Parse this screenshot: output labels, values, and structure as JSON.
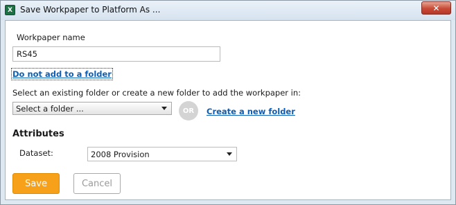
{
  "window": {
    "title": "Save Workpaper to Platform As ...",
    "app_icon_letter": "X",
    "close_glyph": "✕"
  },
  "form": {
    "workpaper_name_label": "Workpaper name",
    "workpaper_name_value": "RS45",
    "no_folder_link": "Do not add to a folder",
    "folder_instruction": "Select an existing folder or create a new folder to add the workpaper in:",
    "folder_select_value": "Select a folder ...",
    "or_badge": "OR",
    "create_folder_link": "Create a new folder",
    "attributes_heading": "Attributes",
    "dataset_label": "Dataset:",
    "dataset_value": "2008 Provision"
  },
  "buttons": {
    "save_label": "Save",
    "cancel_label": "Cancel"
  },
  "colors": {
    "save_button": "#f7a11a",
    "link": "#0b5fb8",
    "close_button": "#c74a36"
  }
}
